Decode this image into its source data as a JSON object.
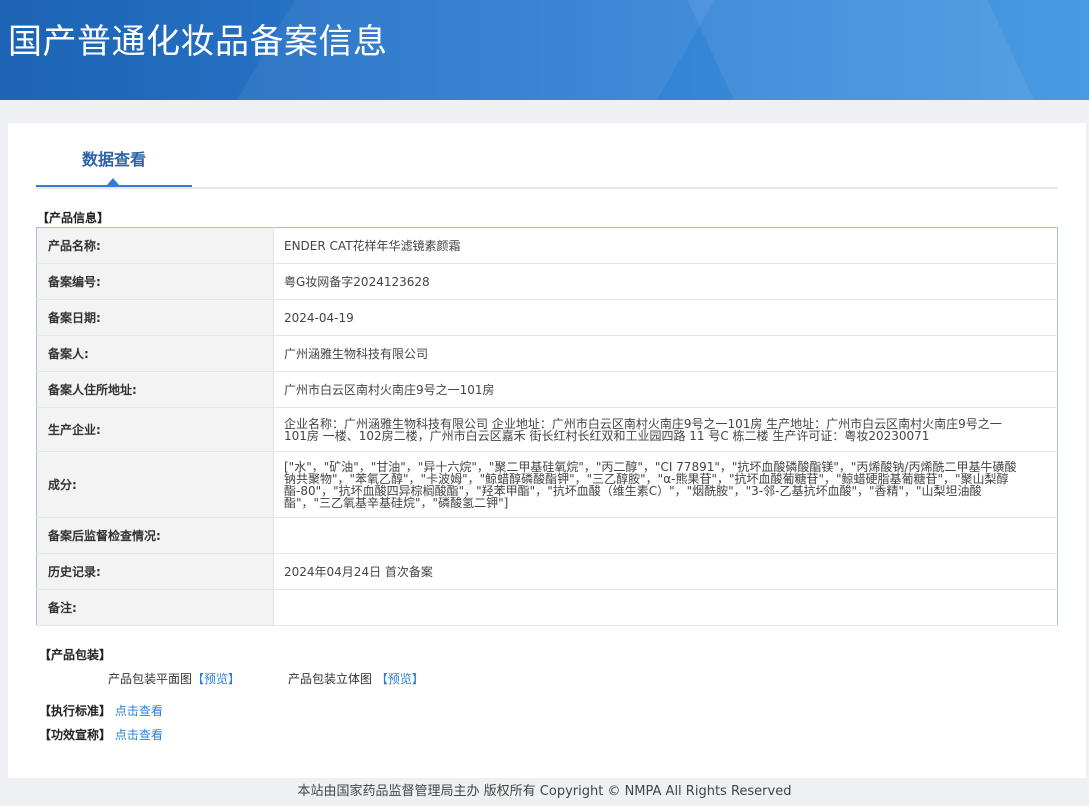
{
  "header": {
    "title": "国产普通化妆品备案信息"
  },
  "tabs": {
    "active": "数据查看"
  },
  "product_info": {
    "section_title": "【产品信息】",
    "rows": [
      {
        "label": "产品名称:",
        "value": "ENDER CAT花样年华滤镜素颜霜"
      },
      {
        "label": "备案编号:",
        "value": "粤G妆网备字2024123628"
      },
      {
        "label": "备案日期:",
        "value": "2024-04-19"
      },
      {
        "label": "备案人:",
        "value": "广州涵雅生物科技有限公司"
      },
      {
        "label": "备案人住所地址:",
        "value": "广州市白云区南村火南庄9号之一101房"
      },
      {
        "label": "生产企业:",
        "value": "企业名称：广州涵雅生物科技有限公司 企业地址：广州市白云区南村火南庄9号之一101房 生产地址：广州市白云区南村火南庄9号之一101房 一楼、102房二楼，广州市白云区嘉禾 街长红村长红双和工业园四路 11 号C 栋二楼 生产许可证：粤妆20230071"
      },
      {
        "label": "成分:",
        "value": "[\"水\"，\"矿油\"，\"甘油\"，\"异十六烷\"，\"聚二甲基硅氧烷\"，\"丙二醇\"，\"CI 77891\"，\"抗坏血酸磷酸酯镁\"，\"丙烯酸钠/丙烯酰二甲基牛磺酸钠共聚物\"，\"苯氧乙醇\"，\"卡波姆\"，\"鲸蜡醇磷酸酯钾\"，\"三乙醇胺\"，\"α-熊果苷\"，\"抗坏血酸葡糖苷\"，\"鲸蜡硬脂基葡糖苷\"，\"聚山梨醇酯-80\"，\"抗坏血酸四异棕榈酸酯\"，\"羟苯甲酯\"，\"抗坏血酸（维生素C）\"，\"烟酰胺\"，\"3-邻-乙基抗坏血酸\"，\"香精\"，\"山梨坦油酸酯\"，\"三乙氧基辛基硅烷\"，\"磷酸氢二钾\"]"
      },
      {
        "label": "备案后监督检查情况:",
        "value": ""
      },
      {
        "label": "历史记录:",
        "value": "2024年04月24日 首次备案"
      },
      {
        "label": "备注:",
        "value": ""
      }
    ]
  },
  "packaging": {
    "section_title": "【产品包装】",
    "flat_label": "产品包装平面图",
    "flat_link": "【预览】",
    "stereo_label": "产品包装立体图",
    "stereo_link": "【预览】"
  },
  "standard": {
    "label": "【执行标准】",
    "link": "点击查看"
  },
  "efficacy": {
    "label": "【功效宣称】",
    "link": "点击查看"
  },
  "footer": {
    "text": "本站由国家药品监督管理局主办 版权所有 Copyright © NMPA All Rights Reserved"
  }
}
